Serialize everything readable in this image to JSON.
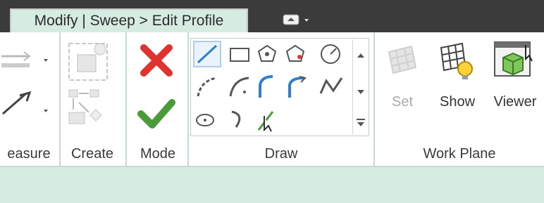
{
  "tabs": {
    "active_label": "Modify | Sweep > Edit Profile",
    "quick_access_icon": "quick-access-dropdown-icon"
  },
  "panels": {
    "measure_label": "easure",
    "create_label": "Create",
    "mode_label": "Mode",
    "draw_label": "Draw",
    "workplane_label": "Work Plane"
  },
  "workplane": {
    "set_label": "Set",
    "show_label": "Show",
    "viewer_label": "Viewer"
  },
  "colors": {
    "ribbon_tint": "#d6ebe2",
    "cancel_red": "#e0322f",
    "finish_green": "#4a9a3a",
    "draw_blue": "#2f7fd0",
    "dark_tab": "#3b3b3b"
  }
}
